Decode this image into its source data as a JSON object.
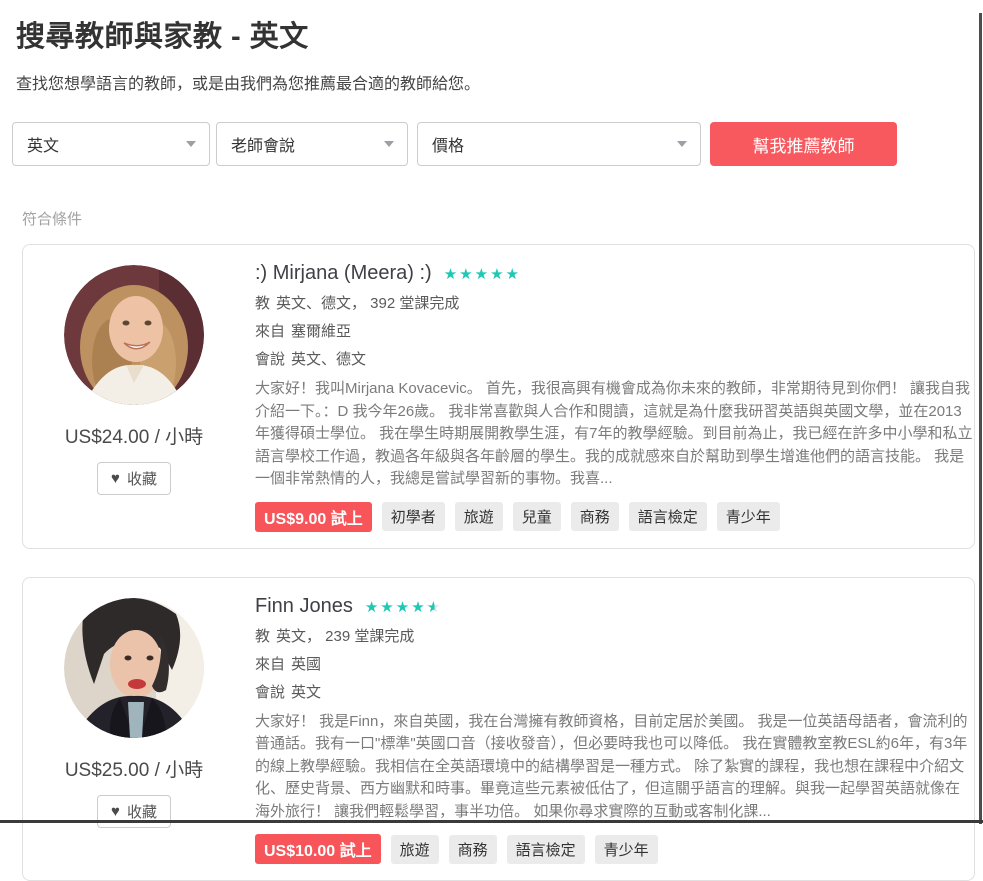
{
  "header": {
    "title": "搜尋教師與家教 - 英文",
    "subtitle": "查找您想學語言的教師，或是由我們為您推薦最合適的教師給您。"
  },
  "filters": {
    "language_value": "英文",
    "teacher_speaks_label": "老師會說",
    "price_label": "價格",
    "recommend_button_label": "幫我推薦教師"
  },
  "results": {
    "section_label": "符合條件"
  },
  "labels": {
    "teaches": "教",
    "from": "來自",
    "speaks": "會說",
    "favorite": "收藏",
    "heart_icon": "♥"
  },
  "colors": {
    "accent_red": "#f8595f",
    "star_teal": "#1fc8b4",
    "tag_gray": "#ebebeb"
  },
  "teachers": [
    {
      "name": ":) Mirjana (Meera) :)",
      "rating": 5,
      "teaches_value": "英文、德文， 392 堂課完成",
      "from_value": "塞爾維亞",
      "speaks_value": "英文、德文",
      "description": "大家好！我叫Mirjana Kovacevic。 首先，我很高興有機會成為你未來的教師，非常期待見到你們！ 讓我自我介紹一下。：D 我今年26歲。 我非常喜歡與人合作和閱讀，這就是為什麼我研習英語與英國文學，並在2013年獲得碩士學位。 我在學生時期展開教學生涯，有7年的教學經驗。到目前為止，我已經在許多中小學和私立語言學校工作過，教過各年級與各年齡層的學生。我的成就感來自於幫助到學生增進他們的語言技能。 我是一個非常熱情的人，我總是嘗試學習新的事物。我喜...",
      "price": "US$24.00 / 小時",
      "trial_badge": "US$9.00 試上",
      "tags": [
        "初學者",
        "旅遊",
        "兒童",
        "商務",
        "語言檢定",
        "青少年"
      ]
    },
    {
      "name": "Finn Jones",
      "rating": 4.5,
      "teaches_value": "英文， 239 堂課完成",
      "from_value": "英國",
      "speaks_value": "英文",
      "description": "大家好！ 我是Finn，來自英國，我在台灣擁有教師資格，目前定居於美國。 我是一位英語母語者，會流利的普通話。我有一口\"標準\"英國口音（接收發音），但必要時我也可以降低。 我在實體教室教ESL約6年，有3年的線上教學經驗。我相信在全英語環境中的結構學習是一種方式。 除了紮實的課程，我也想在課程中介紹文化、歷史背景、西方幽默和時事。畢竟這些元素被低估了，但這關乎語言的理解。與我一起學習英語就像在海外旅行！ 讓我們輕鬆學習，事半功倍。 如果你尋求實際的互動或客制化課...",
      "price": "US$25.00 / 小時",
      "trial_badge": "US$10.00 試上",
      "tags": [
        "旅遊",
        "商務",
        "語言檢定",
        "青少年"
      ]
    }
  ]
}
